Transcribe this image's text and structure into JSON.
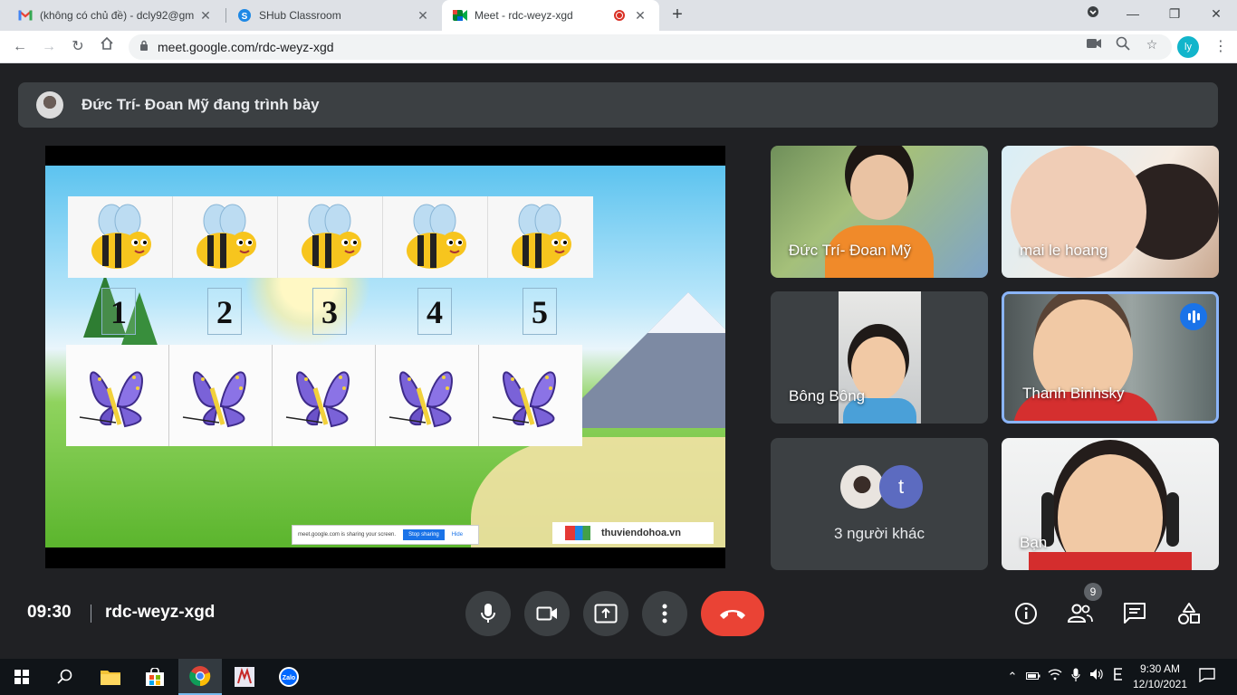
{
  "browser": {
    "tabs": [
      {
        "title": "(không có chủ đề) - dcly92@gm",
        "favicon": "gmail-icon"
      },
      {
        "title": "SHub Classroom",
        "favicon": "shub-icon"
      },
      {
        "title": "Meet - rdc-weyz-xgd",
        "favicon": "meet-icon",
        "active": true
      }
    ],
    "new_tab": "+",
    "url": "meet.google.com/rdc-weyz-xgd",
    "profile_initials": "ly"
  },
  "meet": {
    "presenting_text": "Đức Trí- Đoan Mỹ đang trình bày",
    "slide": {
      "numbers": [
        "1",
        "2",
        "3",
        "4",
        "5"
      ],
      "sharing_notice": "meet.google.com is sharing your screen.",
      "stop_sharing": "Stop sharing",
      "hide": "Hide",
      "watermark": "thuviendohoa.vn"
    },
    "participants": [
      {
        "name": "Đức Trí- Đoan Mỹ"
      },
      {
        "name": "mai le hoang"
      },
      {
        "name": "Bông Bông"
      },
      {
        "name": "Thanh Binhsky",
        "speaking": true
      },
      {
        "name": "Bạn"
      }
    ],
    "others": {
      "label": "3 người khác",
      "avatar_letter": "t"
    },
    "time": "09:30",
    "meeting_code": "rdc-weyz-xgd",
    "people_count": "9"
  },
  "taskbar": {
    "clock_time": "9:30 AM",
    "clock_date": "12/10/2021"
  },
  "colors": {
    "meet_bg": "#202124",
    "tile_bg": "#3c4043",
    "end_call": "#ea4335",
    "accent": "#1a73e8",
    "speaking_border": "#8ab4f8"
  }
}
